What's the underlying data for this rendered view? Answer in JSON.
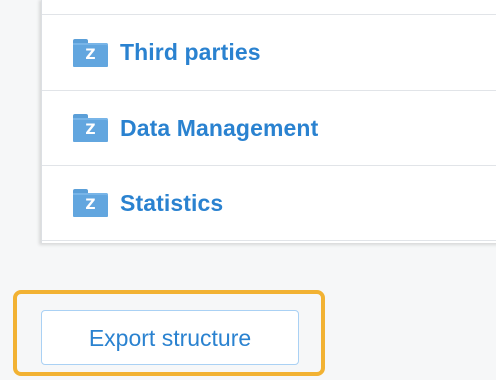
{
  "tree": {
    "items": [
      {
        "label": "Third parties",
        "icon": "folder-icon",
        "icon_letter": "Z"
      },
      {
        "label": "Data Management",
        "icon": "folder-icon",
        "icon_letter": "Z"
      },
      {
        "label": "Statistics",
        "icon": "folder-icon",
        "icon_letter": "Z"
      }
    ]
  },
  "actions": {
    "export_label": "Export structure"
  },
  "colors": {
    "link": "#2a82d0",
    "folder": "#62a6df",
    "highlight": "#f2b233",
    "button_border": "#aad1f4"
  }
}
